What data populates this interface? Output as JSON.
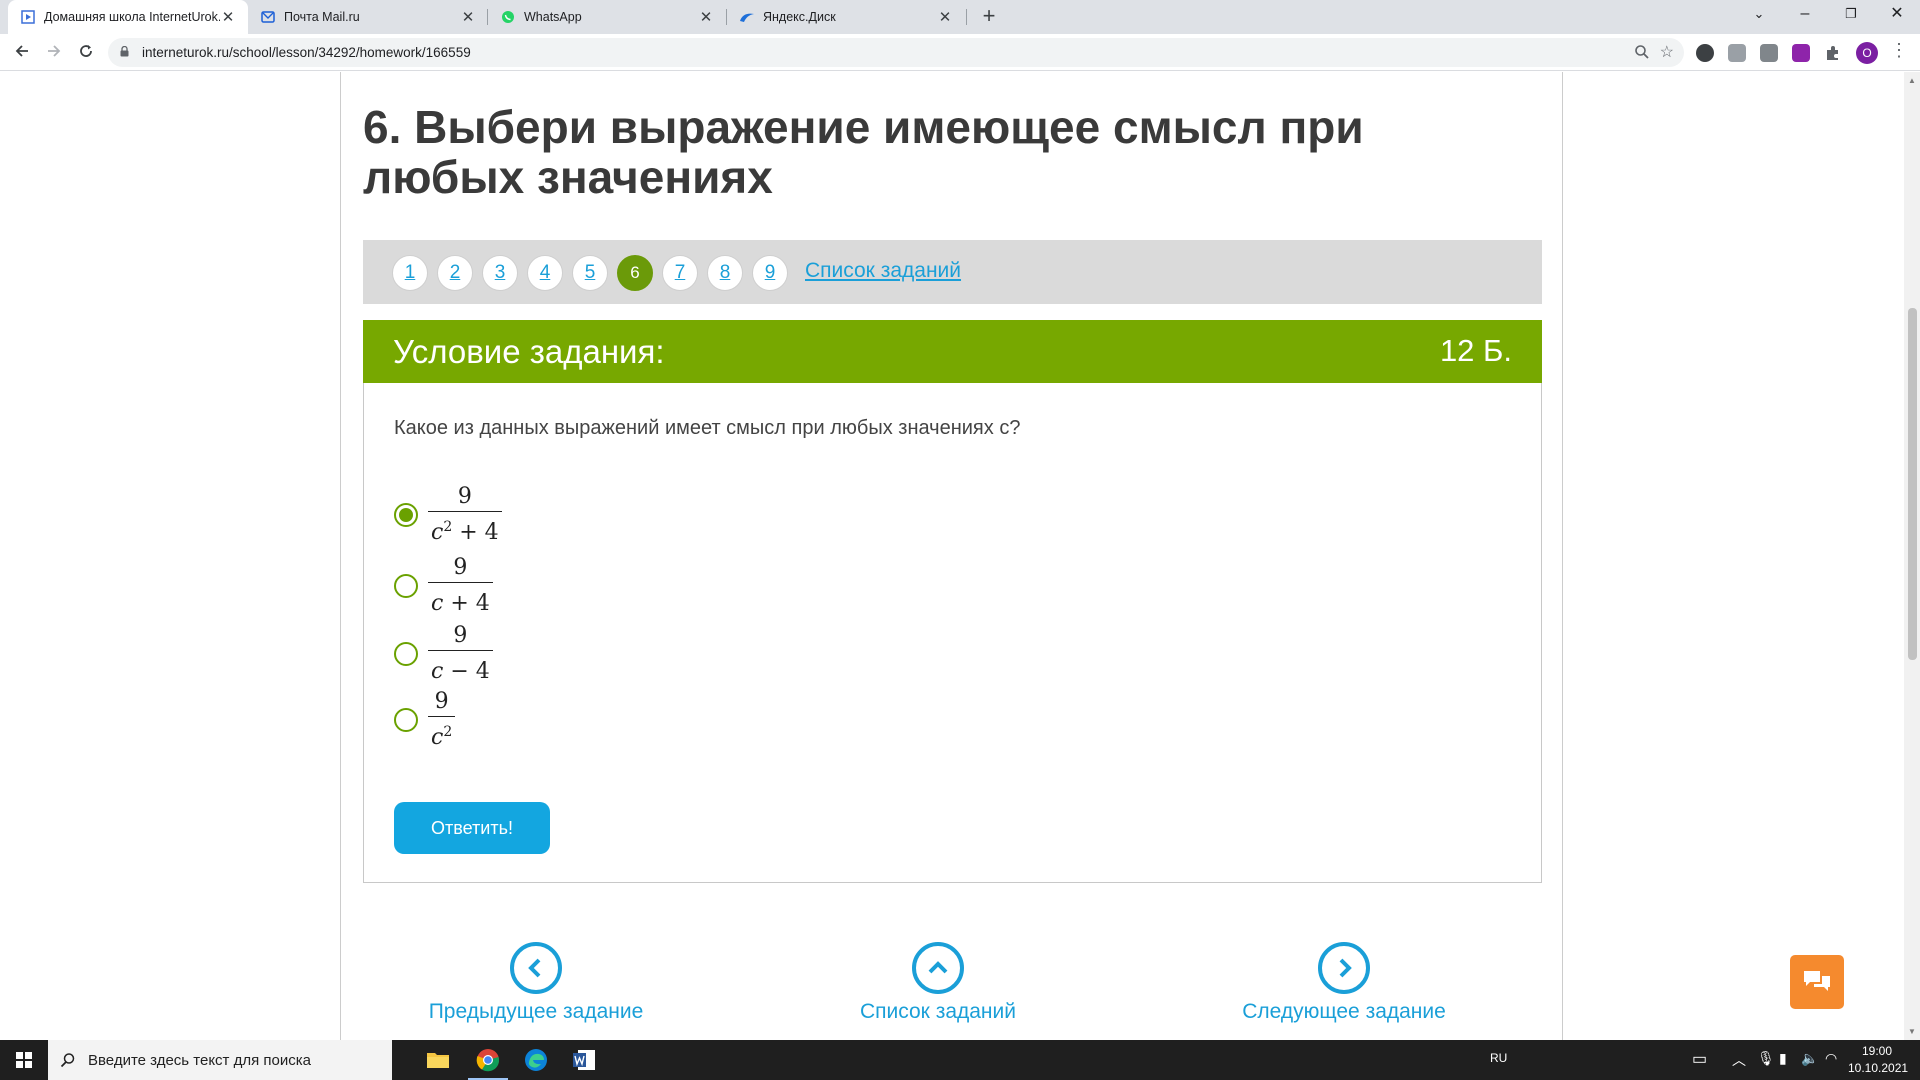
{
  "browser": {
    "tabs": [
      {
        "title": "Домашняя школа InternetUrok.ru"
      },
      {
        "title": "Почта Mail.ru"
      },
      {
        "title": "WhatsApp"
      },
      {
        "title": "Яндекс.Диск"
      }
    ],
    "url": "interneturok.ru/school/lesson/34292/homework/166559",
    "profile_letter": "O"
  },
  "page": {
    "title": "6. Выбери выражение имеющее смысл при любых значениях",
    "pager": {
      "pages": [
        "1",
        "2",
        "3",
        "4",
        "5",
        "6",
        "7",
        "8",
        "9"
      ],
      "current": "6",
      "list_link": "Список заданий"
    },
    "task": {
      "header_label": "Условие задания:",
      "points": "12 Б.",
      "question": "Какое из данных выражений имеет смысл при любых значениях c?",
      "options": [
        {
          "num": "9",
          "den_var": "c",
          "den_exp": "2",
          "den_rest": " + 4",
          "checked": true
        },
        {
          "num": "9",
          "den_var": "c",
          "den_exp": "",
          "den_rest": " + 4",
          "checked": false
        },
        {
          "num": "9",
          "den_var": "c",
          "den_exp": "",
          "den_rest": " − 4",
          "checked": false
        },
        {
          "num": "9",
          "den_var": "c",
          "den_exp": "2",
          "den_rest": "",
          "checked": false
        }
      ],
      "submit_label": "Ответить!"
    },
    "bottom_nav": {
      "prev": "Предыдущее задание",
      "list": "Список заданий",
      "next": "Следующее задание"
    }
  },
  "taskbar": {
    "search_placeholder": "Введите здесь текст для поиска",
    "lang": "RU",
    "time": "19:00",
    "date": "10.10.2021"
  },
  "colors": {
    "accent_green": "#77a800",
    "link_blue": "#1a9fd8",
    "button_blue": "#13a6e0",
    "chat_orange": "#f58a2e"
  }
}
